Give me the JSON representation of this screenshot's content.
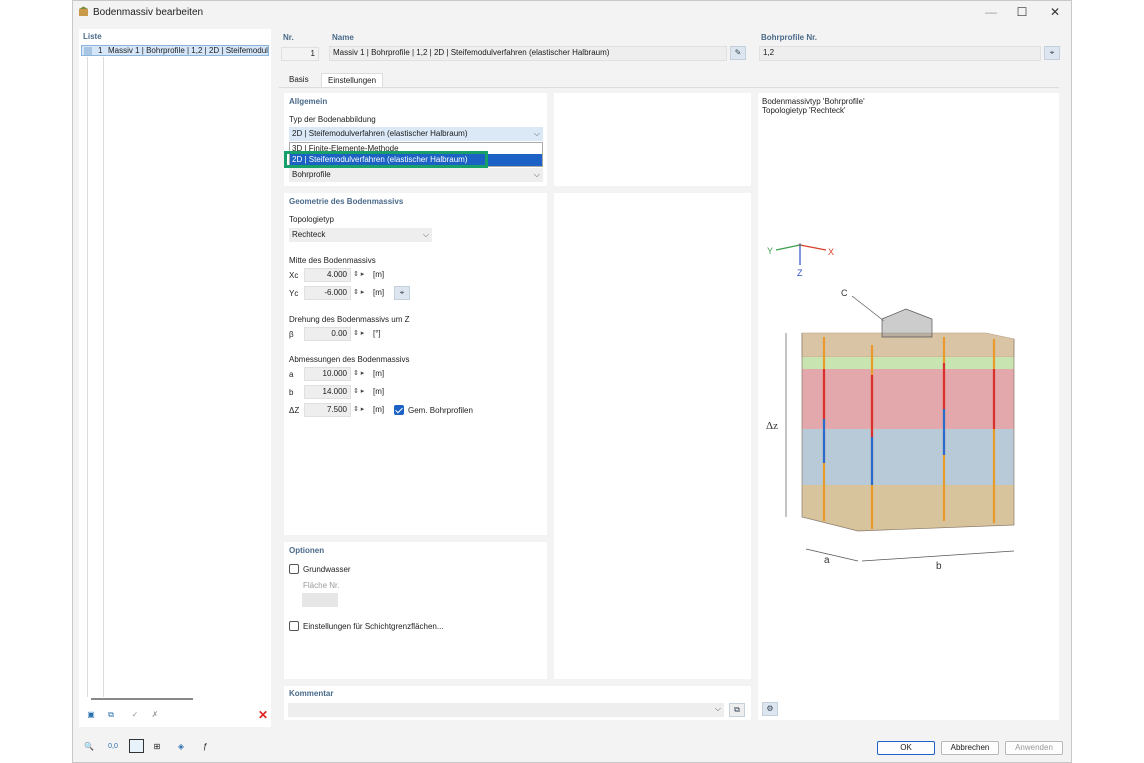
{
  "window": {
    "title": "Bodenmassiv bearbeiten",
    "controls": {
      "minimize": "—",
      "maximize": "☐",
      "close": "✕"
    }
  },
  "list": {
    "header": "Liste",
    "items": [
      {
        "no": "1",
        "label": "Massiv 1 | Bohrprofile | 1,2 | 2D | Steifemodul"
      }
    ]
  },
  "header": {
    "nr_label": "Nr.",
    "nr_value": "1",
    "name_label": "Name",
    "name_value": "Massiv 1 | Bohrprofile | 1,2 | 2D | Steifemodulverfahren (elastischer Halbraum)",
    "profiles_label": "Bohrprofile Nr.",
    "profiles_value": "1,2"
  },
  "tabs": [
    {
      "label": "Basis"
    },
    {
      "label": "Einstellungen"
    }
  ],
  "allgemein": {
    "title": "Allgemein",
    "typ_label": "Typ der Bodenabbildung",
    "typ_value": "2D | Steifemodulverfahren (elastischer Halbraum)",
    "dropdown_options": [
      "3D | Finite-Elemente-Methode",
      "2D | Steifemodulverfahren (elastischer Halbraum)"
    ],
    "massivtyp_value": "Bohrprofile"
  },
  "geometrie": {
    "title": "Geometrie des Bodenmassivs",
    "topologie_label": "Topologietyp",
    "topologie_value": "Rechteck",
    "mitte_label": "Mitte des Bodenmassivs",
    "xc_label": "Xc",
    "xc_value": "4.000",
    "yc_label": "Yc",
    "yc_value": "-6.000",
    "unit_m": "[m]",
    "drehung_label": "Drehung des Bodenmassivs um Z",
    "beta_label": "β",
    "beta_value": "0.00",
    "unit_deg": "[°]",
    "abmessungen_label": "Abmessungen des Bodenmassivs",
    "a_label": "a",
    "a_value": "10.000",
    "b_label": "b",
    "b_value": "14.000",
    "dz_label": "ΔZ",
    "dz_value": "7.500",
    "gem_label": "Gem. Bohrprofilen",
    "gem_checked": true
  },
  "optionen": {
    "title": "Optionen",
    "grundwasser_label": "Grundwasser",
    "grundwasser_checked": false,
    "flaeche_label": "Fläche Nr.",
    "schicht_label": "Einstellungen für Schichtgrenzflächen...",
    "schicht_checked": false
  },
  "preview": {
    "line1": "Bodenmassivtyp 'Bohrprofile'",
    "line2": "Topologietyp 'Rechteck'",
    "axis_x": "X",
    "axis_y": "Y",
    "axis_z": "Z",
    "label_c": "C",
    "label_dz": "Δz",
    "label_a": "a",
    "label_b": "b"
  },
  "kommentar": {
    "title": "Kommentar"
  },
  "footer": {
    "ok": "OK",
    "cancel": "Abbrechen",
    "apply": "Anwenden"
  },
  "colors": {
    "selection": "#1b62c4",
    "highlight_box": "#18a06a",
    "section_title": "#4a6a8a"
  }
}
